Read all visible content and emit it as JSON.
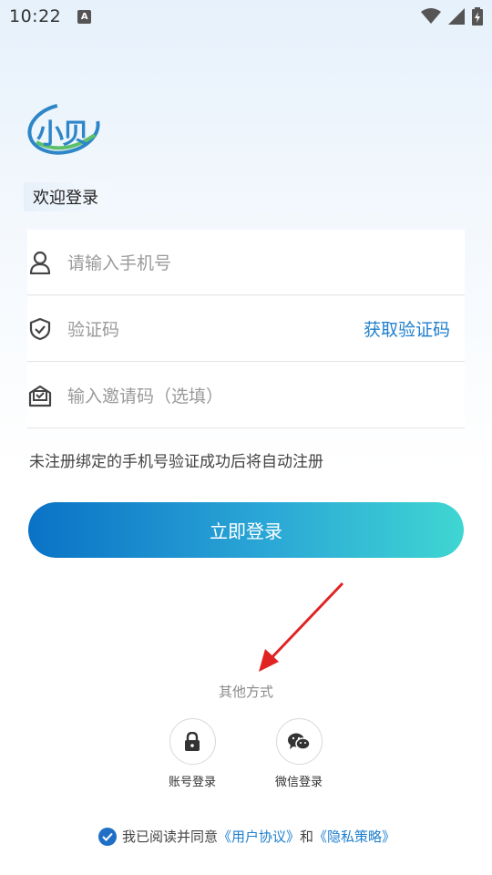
{
  "status_bar": {
    "time": "10:22",
    "notification_badge": "A"
  },
  "brand": {
    "logo_text": "小贝",
    "logo_color": "#2e86c8",
    "accent_green": "#5cc06a"
  },
  "welcome_label": "欢迎登录",
  "form": {
    "phone_placeholder": "请输入手机号",
    "code_placeholder": "验证码",
    "get_code_label": "获取验证码",
    "invite_placeholder": "输入邀请码（选填）"
  },
  "notice": "未注册绑定的手机号验证成功后将自动注册",
  "login_button": "立即登录",
  "other_methods": {
    "title": "其他方式",
    "account_login": "账号登录",
    "wechat_login": "微信登录"
  },
  "agreement": {
    "prefix": "我已阅读并同意",
    "user_agreement": "《用户协议》",
    "conjunction": "和",
    "privacy_policy": "《隐私策略》",
    "checked": true
  },
  "colors": {
    "link": "#1f7fce",
    "button_start": "#0a72c6",
    "button_end": "#3fd6d2",
    "annotation_arrow": "#e02424"
  },
  "icons": [
    "person-icon",
    "shield-check-icon",
    "invite-envelope-icon",
    "lock-icon",
    "wechat-icon",
    "checkmark-icon",
    "wifi-icon",
    "signal-icon",
    "battery-icon"
  ]
}
